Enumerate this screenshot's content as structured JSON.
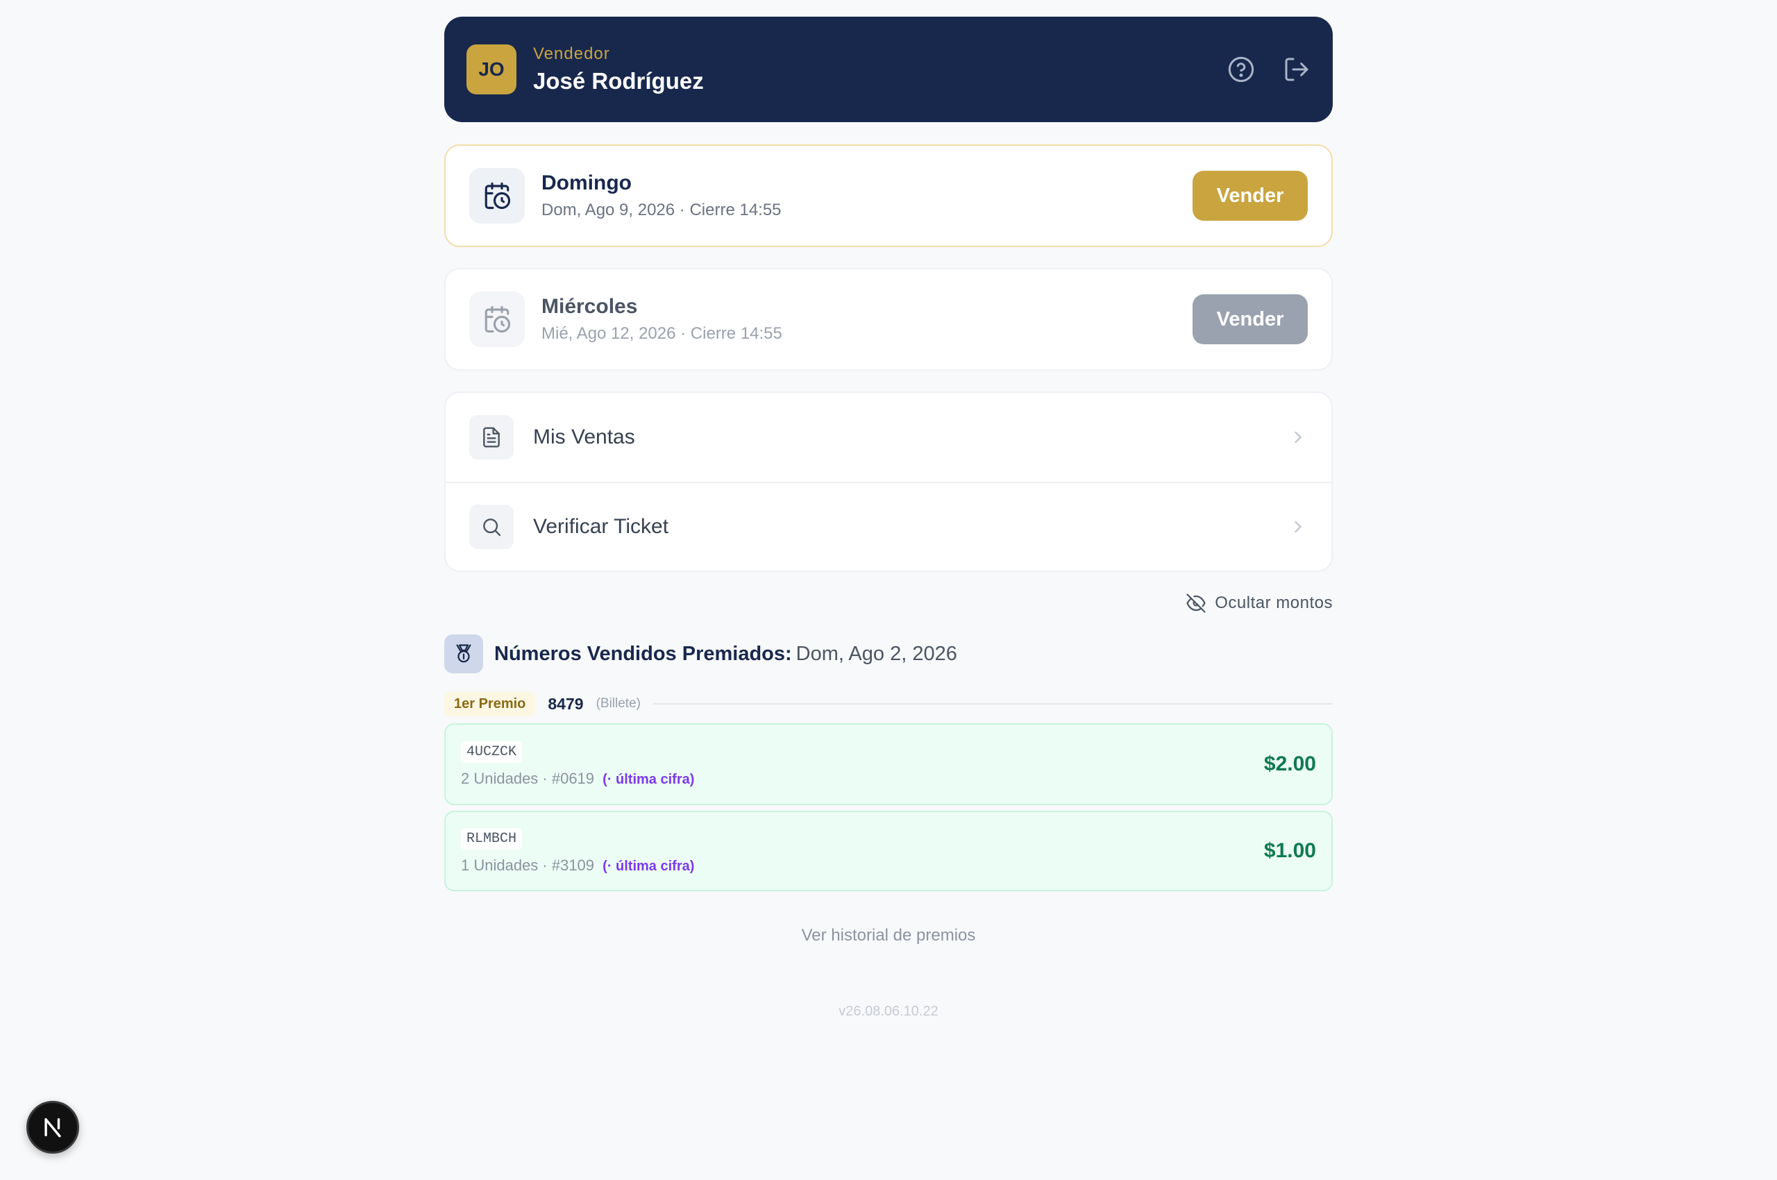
{
  "header": {
    "initials": "JO",
    "role": "Vendedor",
    "name": "José Rodríguez",
    "icons": [
      "help-circle-icon",
      "logout-icon"
    ]
  },
  "draws": [
    {
      "title": "Domingo",
      "subtitle": "Dom, Ago 9, 2026 · Cierre 14:55",
      "button": "Vender",
      "state": "active"
    },
    {
      "title": "Miércoles",
      "subtitle": "Mié, Ago 12, 2026 · Cierre 14:55",
      "button": "Vender",
      "state": "disabled"
    }
  ],
  "menu": [
    {
      "label": "Mis Ventas",
      "icon": "document-icon"
    },
    {
      "label": "Verificar Ticket",
      "icon": "search-icon"
    }
  ],
  "hide_amounts": "Ocultar montos",
  "prizes": {
    "title": "Números Vendidos Premiados:",
    "date": "Dom, Ago 2, 2026",
    "first_prize": {
      "badge": "1er Premio",
      "number": "8479",
      "type": "(Billete)"
    },
    "tickets": [
      {
        "code": "4UCZCK",
        "detail": "2 Unidades · #0619",
        "tag": "(· última cifra)",
        "amount": "$2.00"
      },
      {
        "code": "RLMBCH",
        "detail": "1 Unidades · #3109",
        "tag": "(· última cifra)",
        "amount": "$1.00"
      }
    ],
    "history_link": "Ver historial de premios"
  },
  "version": "v26.08.06.10.22",
  "fab_label": "N",
  "colors": {
    "navy": "#18284d",
    "gold": "#c9a43f",
    "green_amount": "#0f7a52",
    "purple_tag": "#7c3aed"
  }
}
